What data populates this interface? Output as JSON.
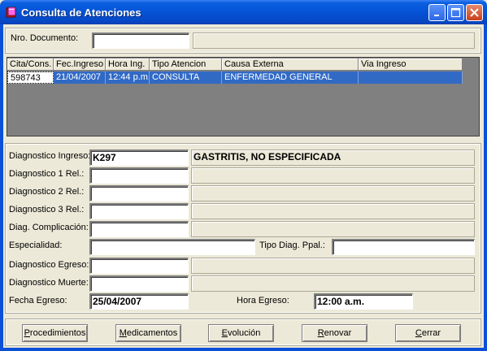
{
  "window": {
    "title": "Consulta de Atenciones"
  },
  "search": {
    "label": "Nro. Documento:",
    "value": "",
    "name_value": ""
  },
  "grid": {
    "columns": [
      "Cita/Cons.",
      "Fec.Ingreso",
      "Hora Ing.",
      "Tipo Atencion",
      "Causa Externa",
      "Via Ingreso"
    ],
    "rows": [
      [
        "598743",
        "21/04/2007",
        "12:44 p.m.",
        "CONSULTA",
        "ENFERMEDAD GENERAL",
        ""
      ]
    ]
  },
  "form": {
    "diag_ingreso": {
      "label": "Diagnostico Ingreso:",
      "code": "K297",
      "desc": "GASTRITIS, NO ESPECIFICADA"
    },
    "diag_1": {
      "label": "Diagnostico 1 Rel.:",
      "code": "",
      "desc": ""
    },
    "diag_2": {
      "label": "Diagnostico 2 Rel.:",
      "code": "",
      "desc": ""
    },
    "diag_3": {
      "label": "Diagnostico 3 Rel.:",
      "code": "",
      "desc": ""
    },
    "diag_comp": {
      "label": "Diag. Complicación:",
      "code": "",
      "desc": ""
    },
    "especialidad": {
      "label": "Especialidad:",
      "value": ""
    },
    "tipo_diag": {
      "label": "Tipo Diag. Ppal.:",
      "value": ""
    },
    "diag_egreso": {
      "label": "Diagnostico Egreso:",
      "code": "",
      "desc": ""
    },
    "diag_muerte": {
      "label": "Diagnostico Muerte:",
      "code": "",
      "desc": ""
    },
    "fecha_egreso": {
      "label": "Fecha Egreso:",
      "value": "25/04/2007"
    },
    "hora_egreso": {
      "label": "Hora Egreso:",
      "value": "12:00 a.m."
    }
  },
  "buttons": {
    "procedimientos": {
      "first": "P",
      "rest": "rocedimientos"
    },
    "medicamentos": {
      "first": "M",
      "rest": "edicamentos"
    },
    "evolucion": {
      "first": "E",
      "rest": "volución"
    },
    "renovar": {
      "first": "R",
      "rest": "enovar"
    },
    "cerrar": {
      "first": "C",
      "rest": "errar"
    }
  },
  "colors": {
    "titlebar": "#0553d6",
    "selection": "#316ac5",
    "face": "#ece9d8"
  },
  "icons": [
    "app-book-icon",
    "minimize-icon",
    "maximize-icon",
    "close-icon"
  ]
}
